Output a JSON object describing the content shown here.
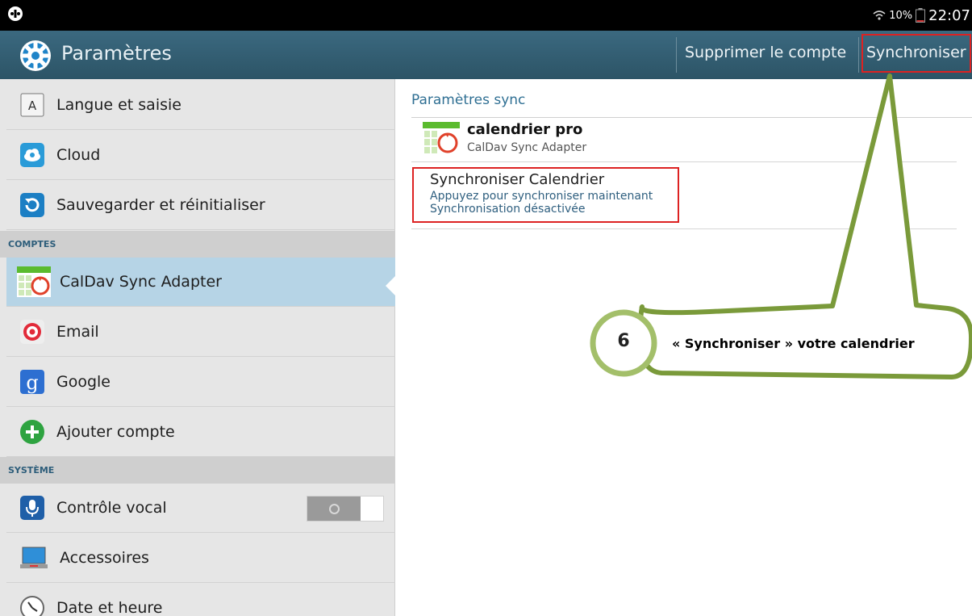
{
  "status_bar": {
    "battery": "10%",
    "time": "22:07"
  },
  "action_bar": {
    "title": "Paramètres",
    "delete_account": "Supprimer le compte",
    "sync": "Synchroniser"
  },
  "sidebar": {
    "items_top": [
      {
        "label": "Langue et saisie",
        "icon": "keyboard-a-icon"
      },
      {
        "label": "Cloud",
        "icon": "cloud-icon"
      },
      {
        "label": "Sauvegarder et réinitialiser",
        "icon": "backup-reset-icon"
      }
    ],
    "section_accounts": "COMPTES",
    "accounts": [
      {
        "label": "CalDav Sync Adapter",
        "icon": "calendar-sync-icon",
        "selected": true
      },
      {
        "label": "Email",
        "icon": "email-icon"
      },
      {
        "label": "Google",
        "icon": "google-icon"
      },
      {
        "label": "Ajouter compte",
        "icon": "add-icon"
      }
    ],
    "section_system": "SYSTÈME",
    "system": [
      {
        "label": "Contrôle vocal",
        "icon": "microphone-icon",
        "toggle": false
      },
      {
        "label": "Accessoires",
        "icon": "laptop-icon"
      },
      {
        "label": "Date et heure",
        "icon": "clock-icon"
      }
    ]
  },
  "content": {
    "header": "Paramètres sync",
    "account_name": "calendrier pro",
    "account_type": "CalDav Sync Adapter",
    "sync_title": "Synchroniser Calendrier",
    "sync_hint": "Appuyez pour synchroniser maintenant",
    "sync_status": "Synchronisation désactivée"
  },
  "callout": {
    "number": "6",
    "text": "« Synchroniser » votre calendrier"
  },
  "colors": {
    "action_bar": "#2f5a6d",
    "selected_row": "#b6d4e6",
    "section_text": "#2d5d7a",
    "highlight": "#dd2222",
    "callout_green": "#7a9a3a"
  }
}
